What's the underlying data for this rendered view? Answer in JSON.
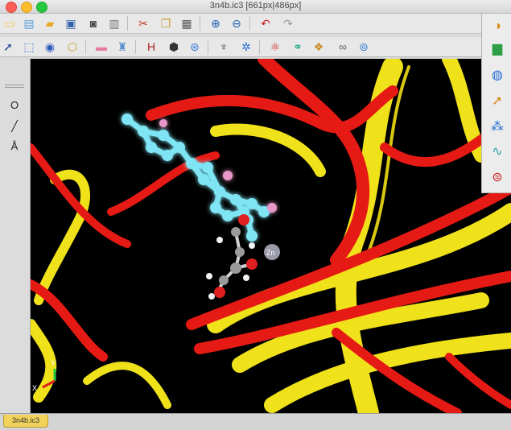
{
  "window": {
    "title": "3n4b.ic3 [661px|486px]"
  },
  "toolbar_top": {
    "items": [
      {
        "name": "new-document-icon",
        "glyph": "▭",
        "color": "#f5c542"
      },
      {
        "name": "new-file-icon",
        "glyph": "▤",
        "color": "#5aa0d8"
      },
      {
        "name": "open-folder-icon",
        "glyph": "▰",
        "color": "#e8a823"
      },
      {
        "name": "save-icon",
        "glyph": "▣",
        "color": "#2f5fa8"
      },
      {
        "name": "camera-icon",
        "glyph": "◙",
        "color": "#444"
      },
      {
        "name": "print-icon",
        "glyph": "▥",
        "color": "#777"
      },
      {
        "name": "cut-icon",
        "glyph": "✂",
        "color": "#c0392b"
      },
      {
        "name": "copy-icon",
        "glyph": "❐",
        "color": "#c99a2e"
      },
      {
        "name": "paste-icon",
        "glyph": "▦",
        "color": "#555"
      },
      {
        "name": "zoom-in-icon",
        "glyph": "⊕",
        "color": "#1e5fb4"
      },
      {
        "name": "zoom-out-icon",
        "glyph": "⊖",
        "color": "#1e5fb4"
      },
      {
        "name": "undo-icon",
        "glyph": "↶",
        "color": "#cc2222"
      },
      {
        "name": "redo-icon",
        "glyph": "↷",
        "color": "#9a9a9a"
      }
    ]
  },
  "toolbar_second": {
    "items": [
      {
        "name": "select-arrow-icon",
        "glyph": "➚",
        "color": "#1a3f8a"
      },
      {
        "name": "lasso-select-icon",
        "glyph": "⬚",
        "color": "#3a6fc4"
      },
      {
        "name": "rotate-3d-icon",
        "glyph": "◉",
        "color": "#2e5bbf"
      },
      {
        "name": "structure-icon",
        "glyph": "⬡",
        "color": "#c9a227"
      },
      {
        "name": "eraser-icon",
        "glyph": "▬",
        "color": "#e87ca0"
      },
      {
        "name": "clean-icon",
        "glyph": "♜",
        "color": "#5a8fd0"
      },
      {
        "name": "add-hydrogens-icon",
        "glyph": "H",
        "color": "#aa2222"
      },
      {
        "name": "stamp-icon",
        "glyph": "⬢",
        "color": "#333"
      },
      {
        "name": "center-icon",
        "glyph": "⊛",
        "color": "#3a7bd5"
      },
      {
        "name": "microscope-icon",
        "glyph": "♆",
        "color": "#444"
      },
      {
        "name": "settings-gear-icon",
        "glyph": "✲",
        "color": "#2a6fd6"
      },
      {
        "name": "atom-style-icon",
        "glyph": "⚛",
        "color": "#cc2222"
      },
      {
        "name": "bond-style-icon",
        "glyph": "⚭",
        "color": "#22aa88"
      },
      {
        "name": "surface-icon",
        "glyph": "❖",
        "color": "#cc8822"
      },
      {
        "name": "link-icon",
        "glyph": "∞",
        "color": "#666"
      },
      {
        "name": "glasses-icon",
        "glyph": "⊚",
        "color": "#3b7fd0"
      }
    ]
  },
  "left_palette": {
    "items": [
      {
        "name": "atom-o-tool",
        "label": "O"
      },
      {
        "name": "bond-line-tool",
        "label": "╱"
      },
      {
        "name": "label-a-tool",
        "label": "Å"
      }
    ]
  },
  "right_palette": {
    "items": [
      {
        "name": "help-icon",
        "glyph": "◑",
        "color": "#d98c1c"
      },
      {
        "name": "bar-chart-icon",
        "glyph": "▆",
        "color": "#2e9e44"
      },
      {
        "name": "speedometer-icon",
        "glyph": "◍",
        "color": "#2a6fd6"
      },
      {
        "name": "pointer-tool-icon",
        "glyph": "➚",
        "color": "#d9861a"
      },
      {
        "name": "molecule-tool-icon",
        "glyph": "⁂",
        "color": "#2a6fd6"
      },
      {
        "name": "chain-tool-icon",
        "glyph": "∿",
        "color": "#2aa4a4"
      },
      {
        "name": "atoms-stack-icon",
        "glyph": "⊜",
        "color": "#cc2222"
      }
    ]
  },
  "viewport": {
    "axis_y_label": "Y",
    "axis_x_label": "X",
    "zinc_label": "Zn",
    "colors": {
      "ribbon_red": "#e61a14",
      "ribbon_yellow": "#f0e21a",
      "ligand": "#7fe5f5",
      "glow": "#1f8fe0",
      "carbon": "#9a9a9a",
      "oxygen": "#e02020",
      "hydrogen": "#f2f2f2",
      "zinc": "#9a9aaa"
    }
  },
  "status": {
    "document_tab": "3n4b.ic3"
  }
}
